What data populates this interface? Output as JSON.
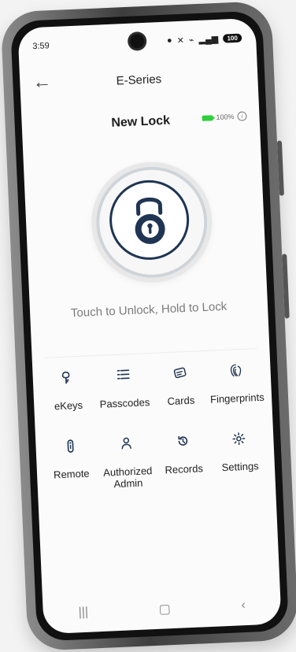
{
  "status_bar": {
    "time": "3:59",
    "battery_text": "100"
  },
  "header": {
    "title": "E-Series"
  },
  "lock": {
    "name": "New Lock",
    "battery": "100%"
  },
  "unlock": {
    "helper_text": "Touch to Unlock, Hold to Lock"
  },
  "menu": {
    "items": [
      {
        "label": "eKeys",
        "icon": "ekey-icon"
      },
      {
        "label": "Passcodes",
        "icon": "passcodes-icon"
      },
      {
        "label": "Cards",
        "icon": "card-icon"
      },
      {
        "label": "Fingerprints",
        "icon": "fingerprint-icon"
      },
      {
        "label": "Remote",
        "icon": "remote-icon"
      },
      {
        "label": "Authorized\nAdmin",
        "icon": "authorized-admin-icon"
      },
      {
        "label": "Records",
        "icon": "records-icon"
      },
      {
        "label": "Settings",
        "icon": "settings-icon"
      }
    ]
  },
  "colors": {
    "accent_navy": "#1f3553",
    "battery_green": "#2fcf3b"
  }
}
